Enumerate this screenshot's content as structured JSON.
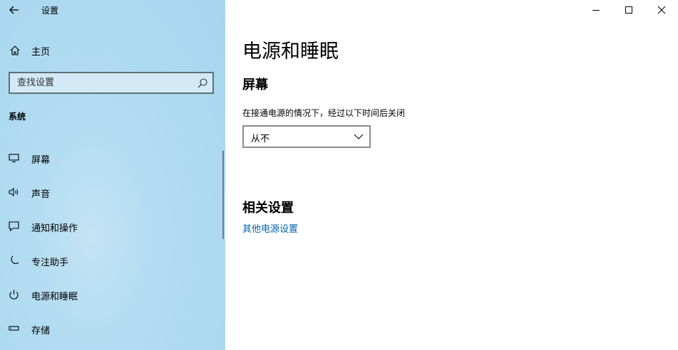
{
  "window": {
    "title": "设置",
    "controls": [
      "minimize-icon",
      "maximize-icon",
      "close-icon"
    ]
  },
  "sidebar": {
    "home_label": "主页",
    "search_placeholder": "查找设置",
    "section_title": "系统",
    "items": [
      {
        "label": "屏幕",
        "icon": "display-icon"
      },
      {
        "label": "声音",
        "icon": "speaker-icon"
      },
      {
        "label": "通知和操作",
        "icon": "notification-icon"
      },
      {
        "label": "专注助手",
        "icon": "moon-icon"
      },
      {
        "label": "电源和睡眠",
        "icon": "power-icon"
      },
      {
        "label": "存储",
        "icon": "storage-icon"
      }
    ]
  },
  "main": {
    "page_title": "电源和睡眠",
    "screen_section": "屏幕",
    "screen_label": "在接通电源的情况下，经过以下时间后关闭",
    "screen_value": "从不",
    "related_title": "相关设置",
    "related_link": "其他电源设置"
  },
  "colors": {
    "sidebar_bg": "#a7d6ef",
    "link": "#0063b1",
    "accent_border": "#5f6f78"
  }
}
